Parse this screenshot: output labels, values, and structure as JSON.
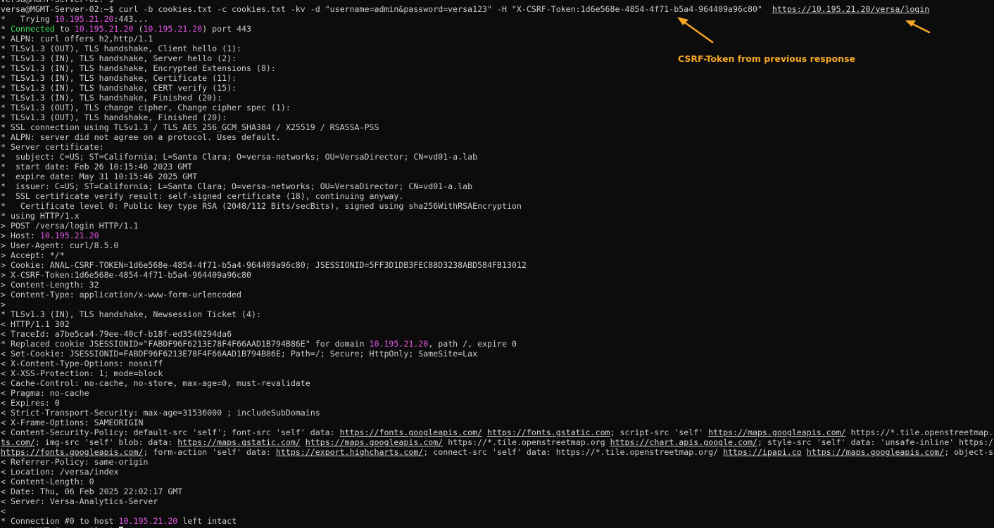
{
  "terminal": {
    "lines": [
      [
        {
          "t": "versa@MGMT-Server-02:~$ "
        }
      ],
      [
        {
          "t": "versa@MGMT-Server-02:~$ curl -b cookies.txt -c cookies.txt -kv -d \"username=admin&password=versa123\" -H \"X-CSRF-Token:1d6e568e-4854-4f71-b5a4-964409a96c80\"  "
        },
        {
          "t": "https://10.195.21.20/versa/login",
          "c": "url"
        }
      ],
      [
        {
          "t": "*   Trying "
        },
        {
          "t": "10.195.21.20",
          "c": "ip"
        },
        {
          "t": ":443..."
        }
      ],
      [
        {
          "t": "* "
        },
        {
          "t": "Connected",
          "c": "grn"
        },
        {
          "t": " to "
        },
        {
          "t": "10.195.21.20",
          "c": "ip"
        },
        {
          "t": " ("
        },
        {
          "t": "10.195.21.20",
          "c": "ip"
        },
        {
          "t": ") port 443"
        }
      ],
      [
        {
          "t": "* ALPN: curl offers h2,http/1.1"
        }
      ],
      [
        {
          "t": "* TLSv1.3 (OUT), TLS handshake, Client hello (1):"
        }
      ],
      [
        {
          "t": "* TLSv1.3 (IN), TLS handshake, Server hello (2):"
        }
      ],
      [
        {
          "t": "* TLSv1.3 (IN), TLS handshake, Encrypted Extensions (8):"
        }
      ],
      [
        {
          "t": "* TLSv1.3 (IN), TLS handshake, Certificate (11):"
        }
      ],
      [
        {
          "t": "* TLSv1.3 (IN), TLS handshake, CERT verify (15):"
        }
      ],
      [
        {
          "t": "* TLSv1.3 (IN), TLS handshake, Finished (20):"
        }
      ],
      [
        {
          "t": "* TLSv1.3 (OUT), TLS change cipher, Change cipher spec (1):"
        }
      ],
      [
        {
          "t": "* TLSv1.3 (OUT), TLS handshake, Finished (20):"
        }
      ],
      [
        {
          "t": "* SSL connection using TLSv1.3 / TLS_AES_256_GCM_SHA384 / X25519 / RSASSA-PSS"
        }
      ],
      [
        {
          "t": "* ALPN: server did not agree on a protocol. Uses default."
        }
      ],
      [
        {
          "t": "* Server certificate:"
        }
      ],
      [
        {
          "t": "*  subject: C=US; ST=California; L=Santa Clara; O=versa-networks; OU=VersaDirector; CN=vd01-a.lab"
        }
      ],
      [
        {
          "t": "*  start date: Feb 26 10:15:46 2023 GMT"
        }
      ],
      [
        {
          "t": "*  expire date: May 31 10:15:46 2025 GMT"
        }
      ],
      [
        {
          "t": "*  issuer: C=US; ST=California; L=Santa Clara; O=versa-networks; OU=VersaDirector; CN=vd01-a.lab"
        }
      ],
      [
        {
          "t": "*  SSL certificate verify result: self-signed certificate (18), continuing anyway."
        }
      ],
      [
        {
          "t": "*   Certificate level 0: Public key type RSA (2048/112 Bits/secBits), signed using sha256WithRSAEncryption"
        }
      ],
      [
        {
          "t": "* using HTTP/1.x"
        }
      ],
      [
        {
          "t": "> POST /versa/login HTTP/1.1"
        }
      ],
      [
        {
          "t": "> Host: "
        },
        {
          "t": "10.195.21.20",
          "c": "ip"
        }
      ],
      [
        {
          "t": "> User-Agent: curl/8.5.0"
        }
      ],
      [
        {
          "t": "> Accept: */*"
        }
      ],
      [
        {
          "t": "> Cookie: ANAL-CSRF-TOKEN=1d6e568e-4854-4f71-b5a4-964409a96c80; JSESSIONID=5FF3D1DB3FEC88D3238ABD584FB13012"
        }
      ],
      [
        {
          "t": "> X-CSRF-Token:1d6e568e-4854-4f71-b5a4-964409a96c80"
        }
      ],
      [
        {
          "t": "> Content-Length: 32"
        }
      ],
      [
        {
          "t": "> Content-Type: application/x-www-form-urlencoded"
        }
      ],
      [
        {
          "t": ">"
        }
      ],
      [
        {
          "t": "* TLSv1.3 (IN), TLS handshake, Newsession Ticket (4):"
        }
      ],
      [
        {
          "t": "< HTTP/1.1 302"
        }
      ],
      [
        {
          "t": "< TraceId: a7be5ca4-79ee-40cf-b18f-ed3540294da6"
        }
      ],
      [
        {
          "t": "* Replaced cookie JSESSIONID=\"FABDF96F6213E78F4F66AAD1B794B86E\" for domain "
        },
        {
          "t": "10.195.21.20",
          "c": "ip"
        },
        {
          "t": ", path /, expire 0"
        }
      ],
      [
        {
          "t": "< Set-Cookie: JSESSIONID=FABDF96F6213E78F4F66AAD1B794B86E; Path=/; Secure; HttpOnly; SameSite=Lax"
        }
      ],
      [
        {
          "t": "< X-Content-Type-Options: nosniff"
        }
      ],
      [
        {
          "t": "< X-XSS-Protection: 1; mode=block"
        }
      ],
      [
        {
          "t": "< Cache-Control: no-cache, no-store, max-age=0, must-revalidate"
        }
      ],
      [
        {
          "t": "< Pragma: no-cache"
        }
      ],
      [
        {
          "t": "< Expires: 0"
        }
      ],
      [
        {
          "t": "< Strict-Transport-Security: max-age=31536000 ; includeSubDomains"
        }
      ],
      [
        {
          "t": "< X-Frame-Options: SAMEORIGIN"
        }
      ],
      [
        {
          "t": "< Content-Security-Policy: default-src 'self'; font-src 'self' data: "
        },
        {
          "t": "https://fonts.googleapis.com/",
          "c": "url"
        },
        {
          "t": " "
        },
        {
          "t": "https://fonts.gstatic.com",
          "c": "url"
        },
        {
          "t": "; script-src 'self' "
        },
        {
          "t": "https://maps.googleapis.com/",
          "c": "url"
        },
        {
          "t": " https://*.tile.openstreetmap."
        }
      ],
      [
        {
          "t": "ts.com/",
          "c": "url"
        },
        {
          "t": "; img-src 'self' blob: data: "
        },
        {
          "t": "https://maps.gstatic.com/",
          "c": "url"
        },
        {
          "t": " "
        },
        {
          "t": "https://maps.googleapis.com/",
          "c": "url"
        },
        {
          "t": " https://*.tile.openstreetmap.org "
        },
        {
          "t": "https://chart.apis.google.com/",
          "c": "url"
        },
        {
          "t": "; style-src 'self' data: 'unsafe-inline' https:/"
        }
      ],
      [
        {
          "t": "https://fonts.googleapis.com/",
          "c": "url"
        },
        {
          "t": "; form-action 'self' data: "
        },
        {
          "t": "https://export.highcharts.com/",
          "c": "url"
        },
        {
          "t": "; connect-src 'self' data: https://*.tile.openstreetmap.org/ "
        },
        {
          "t": "https://ipapi.co",
          "c": "url"
        },
        {
          "t": " "
        },
        {
          "t": "https://maps.googleapis.com/",
          "c": "url"
        },
        {
          "t": "; object-sr"
        }
      ],
      [
        {
          "t": "< Referrer-Policy: same-origin"
        }
      ],
      [
        {
          "t": "< Location: /versa/index"
        }
      ],
      [
        {
          "t": "< Content-Length: 0"
        }
      ],
      [
        {
          "t": "< Date: Thu, 06 Feb 2025 22:02:17 GMT"
        }
      ],
      [
        {
          "t": "< Server: Versa-Analytics-Server"
        }
      ],
      [
        {
          "t": "<"
        }
      ],
      [
        {
          "t": "* Connection #0 to host "
        },
        {
          "t": "10.195.21.20",
          "c": "ip"
        },
        {
          "t": " left intact"
        }
      ],
      [
        {
          "t": "versa@MGMT-Server-02:~$ "
        },
        {
          "t": "",
          "c": "cursor"
        }
      ]
    ]
  },
  "annotation": {
    "label": "CSRF-Token from previous response",
    "color": "#f5a623"
  },
  "colors": {
    "background": "#0c0c0c",
    "text": "#cccccc",
    "ip": "#e356e3",
    "connected": "#3fdc5c"
  }
}
